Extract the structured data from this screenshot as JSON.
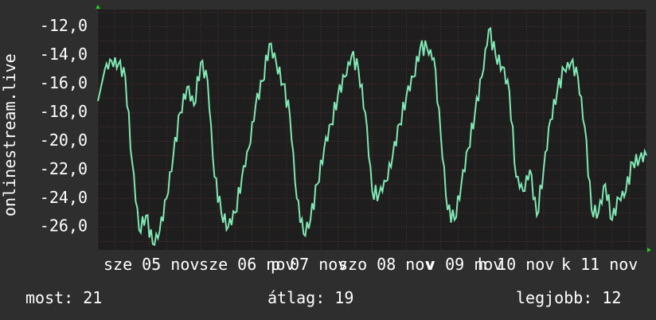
{
  "chart_data": {
    "type": "line",
    "ylabel": "onlinestream.live",
    "ylim": [
      -27.6,
      -10.8
    ],
    "yticks": [
      -12,
      -14,
      -16,
      -18,
      -20,
      -22,
      -24,
      -26
    ],
    "ytick_labels": [
      "-12,0",
      "-14,0",
      "-16,0",
      "-18,0",
      "-20,0",
      "-22,0",
      "-24,0",
      "-26,0"
    ],
    "x_labels": [
      "sze 05 nov",
      "sze 06 nov",
      "p 07 nov",
      "szo 08 nov",
      "v 09 nov",
      "h 10 nov",
      "k 11 nov"
    ],
    "x_label_renders": [
      "sze 05 nov",
      "sze 06 nov",
      "p 07 nov",
      "szo 08 nov",
      "v 09 nov",
      "h 10 nov",
      "k 11 nov"
    ],
    "series": [
      {
        "color": "#7fe8b4",
        "x": [
          0,
          0.1,
          0.2,
          0.3,
          0.4,
          0.5,
          0.6,
          0.7,
          0.8,
          0.9,
          1.0,
          1.1,
          1.2,
          1.3,
          1.4,
          1.5,
          1.6,
          1.7,
          1.8,
          1.9,
          2.0,
          2.1,
          2.2,
          2.3,
          2.4,
          2.5,
          2.6,
          2.7,
          2.8,
          2.9,
          3.0,
          3.1,
          3.2,
          3.3,
          3.4,
          3.5,
          3.6,
          3.7,
          3.8,
          3.9,
          4.0,
          4.1,
          4.2,
          4.3,
          4.4,
          4.5,
          4.6,
          4.7,
          4.8,
          4.9,
          5.0,
          5.1,
          5.2,
          5.3,
          5.4,
          5.5,
          5.6,
          5.7,
          5.8,
          5.9,
          6.0,
          6.1,
          6.2,
          6.3,
          6.4,
          6.5,
          6.6,
          6.7,
          6.8,
          6.9,
          7.0,
          7.1,
          7.2,
          7.3,
          7.4,
          7.5,
          7.6,
          7.7,
          7.8,
          7.9,
          8.0
        ],
        "values": [
          -17.2,
          -15.0,
          -14.4,
          -14.6,
          -15.5,
          -21.5,
          -26.2,
          -25.2,
          -27.2,
          -26.3,
          -24.0,
          -21.0,
          -18.0,
          -16.2,
          -17.5,
          -14.5,
          -15.8,
          -22.5,
          -25.0,
          -26.0,
          -25.0,
          -22.5,
          -20.5,
          -17.5,
          -15.8,
          -13.2,
          -14.5,
          -16.0,
          -18.2,
          -24.0,
          -26.5,
          -25.5,
          -23.0,
          -20.5,
          -18.8,
          -16.8,
          -15.5,
          -14.0,
          -15.0,
          -18.0,
          -23.5,
          -23.7,
          -22.8,
          -21.0,
          -18.8,
          -16.8,
          -15.5,
          -13.5,
          -13.5,
          -14.2,
          -19.5,
          -24.8,
          -25.5,
          -23.0,
          -20.5,
          -18.0,
          -15.5,
          -12.2,
          -14.0,
          -14.8,
          -16.5,
          -22.5,
          -23.5,
          -22.0,
          -25.2,
          -22.0,
          -18.5,
          -16.5,
          -15.0,
          -14.5,
          -15.5,
          -19.0,
          -24.8,
          -25.0,
          -23.0,
          -25.5,
          -24.0,
          -23.5,
          -21.5,
          -21.2,
          -21.0
        ],
        "jitter": [
          0,
          0.3,
          -0.4,
          0.5,
          -0.6,
          0.4,
          -0.5,
          0.6,
          -0.3,
          0.5,
          -0.4,
          0.6,
          -0.5,
          0.4,
          -0.6,
          0.5,
          -0.3,
          0.6,
          -0.5,
          0.4,
          -0.6,
          0.3,
          -0.4,
          0.5,
          -0.6,
          0.4,
          -0.5,
          0.6,
          -0.3,
          0.5,
          -0.4,
          0.6,
          -0.5,
          0.4,
          -0.6,
          0.5,
          -0.3,
          0.6,
          -0.5,
          0.4,
          -0.6,
          0.3,
          -0.4,
          0.5,
          -0.6,
          0.4,
          -0.5,
          0.6,
          -0.3,
          0.5,
          -0.4,
          0.6,
          -0.5,
          0.4,
          -0.6,
          0.5,
          -0.3,
          0.6,
          -0.5,
          0.4,
          -0.6,
          0.3,
          -0.4,
          0.5,
          -0.6,
          0.4,
          -0.5,
          0.6,
          -0.3,
          0.5,
          -0.4,
          0.6,
          -0.5,
          0.4,
          -0.6,
          0.5,
          -0.3,
          0.6,
          -0.5,
          0.4,
          0
        ]
      }
    ],
    "grid": true
  },
  "stats": {
    "current": "most: 21",
    "average": "átlag: 19",
    "best": "legjobb: 12"
  },
  "colors": {
    "background": "#2e2e2e",
    "plot_background": "#1e1e1e",
    "grid": "#5a3030",
    "line": "#7fe8b4",
    "axis_arrow": "#22cc22"
  }
}
